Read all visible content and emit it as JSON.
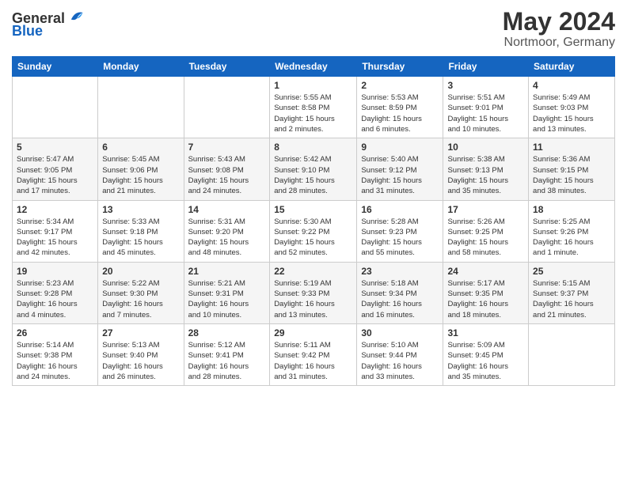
{
  "logo": {
    "general": "General",
    "blue": "Blue"
  },
  "title": {
    "month": "May 2024",
    "location": "Nortmoor, Germany"
  },
  "headers": [
    "Sunday",
    "Monday",
    "Tuesday",
    "Wednesday",
    "Thursday",
    "Friday",
    "Saturday"
  ],
  "weeks": [
    [
      {
        "day": "",
        "info": ""
      },
      {
        "day": "",
        "info": ""
      },
      {
        "day": "",
        "info": ""
      },
      {
        "day": "1",
        "info": "Sunrise: 5:55 AM\nSunset: 8:58 PM\nDaylight: 15 hours\nand 2 minutes."
      },
      {
        "day": "2",
        "info": "Sunrise: 5:53 AM\nSunset: 8:59 PM\nDaylight: 15 hours\nand 6 minutes."
      },
      {
        "day": "3",
        "info": "Sunrise: 5:51 AM\nSunset: 9:01 PM\nDaylight: 15 hours\nand 10 minutes."
      },
      {
        "day": "4",
        "info": "Sunrise: 5:49 AM\nSunset: 9:03 PM\nDaylight: 15 hours\nand 13 minutes."
      }
    ],
    [
      {
        "day": "5",
        "info": "Sunrise: 5:47 AM\nSunset: 9:05 PM\nDaylight: 15 hours\nand 17 minutes."
      },
      {
        "day": "6",
        "info": "Sunrise: 5:45 AM\nSunset: 9:06 PM\nDaylight: 15 hours\nand 21 minutes."
      },
      {
        "day": "7",
        "info": "Sunrise: 5:43 AM\nSunset: 9:08 PM\nDaylight: 15 hours\nand 24 minutes."
      },
      {
        "day": "8",
        "info": "Sunrise: 5:42 AM\nSunset: 9:10 PM\nDaylight: 15 hours\nand 28 minutes."
      },
      {
        "day": "9",
        "info": "Sunrise: 5:40 AM\nSunset: 9:12 PM\nDaylight: 15 hours\nand 31 minutes."
      },
      {
        "day": "10",
        "info": "Sunrise: 5:38 AM\nSunset: 9:13 PM\nDaylight: 15 hours\nand 35 minutes."
      },
      {
        "day": "11",
        "info": "Sunrise: 5:36 AM\nSunset: 9:15 PM\nDaylight: 15 hours\nand 38 minutes."
      }
    ],
    [
      {
        "day": "12",
        "info": "Sunrise: 5:34 AM\nSunset: 9:17 PM\nDaylight: 15 hours\nand 42 minutes."
      },
      {
        "day": "13",
        "info": "Sunrise: 5:33 AM\nSunset: 9:18 PM\nDaylight: 15 hours\nand 45 minutes."
      },
      {
        "day": "14",
        "info": "Sunrise: 5:31 AM\nSunset: 9:20 PM\nDaylight: 15 hours\nand 48 minutes."
      },
      {
        "day": "15",
        "info": "Sunrise: 5:30 AM\nSunset: 9:22 PM\nDaylight: 15 hours\nand 52 minutes."
      },
      {
        "day": "16",
        "info": "Sunrise: 5:28 AM\nSunset: 9:23 PM\nDaylight: 15 hours\nand 55 minutes."
      },
      {
        "day": "17",
        "info": "Sunrise: 5:26 AM\nSunset: 9:25 PM\nDaylight: 15 hours\nand 58 minutes."
      },
      {
        "day": "18",
        "info": "Sunrise: 5:25 AM\nSunset: 9:26 PM\nDaylight: 16 hours\nand 1 minute."
      }
    ],
    [
      {
        "day": "19",
        "info": "Sunrise: 5:23 AM\nSunset: 9:28 PM\nDaylight: 16 hours\nand 4 minutes."
      },
      {
        "day": "20",
        "info": "Sunrise: 5:22 AM\nSunset: 9:30 PM\nDaylight: 16 hours\nand 7 minutes."
      },
      {
        "day": "21",
        "info": "Sunrise: 5:21 AM\nSunset: 9:31 PM\nDaylight: 16 hours\nand 10 minutes."
      },
      {
        "day": "22",
        "info": "Sunrise: 5:19 AM\nSunset: 9:33 PM\nDaylight: 16 hours\nand 13 minutes."
      },
      {
        "day": "23",
        "info": "Sunrise: 5:18 AM\nSunset: 9:34 PM\nDaylight: 16 hours\nand 16 minutes."
      },
      {
        "day": "24",
        "info": "Sunrise: 5:17 AM\nSunset: 9:35 PM\nDaylight: 16 hours\nand 18 minutes."
      },
      {
        "day": "25",
        "info": "Sunrise: 5:15 AM\nSunset: 9:37 PM\nDaylight: 16 hours\nand 21 minutes."
      }
    ],
    [
      {
        "day": "26",
        "info": "Sunrise: 5:14 AM\nSunset: 9:38 PM\nDaylight: 16 hours\nand 24 minutes."
      },
      {
        "day": "27",
        "info": "Sunrise: 5:13 AM\nSunset: 9:40 PM\nDaylight: 16 hours\nand 26 minutes."
      },
      {
        "day": "28",
        "info": "Sunrise: 5:12 AM\nSunset: 9:41 PM\nDaylight: 16 hours\nand 28 minutes."
      },
      {
        "day": "29",
        "info": "Sunrise: 5:11 AM\nSunset: 9:42 PM\nDaylight: 16 hours\nand 31 minutes."
      },
      {
        "day": "30",
        "info": "Sunrise: 5:10 AM\nSunset: 9:44 PM\nDaylight: 16 hours\nand 33 minutes."
      },
      {
        "day": "31",
        "info": "Sunrise: 5:09 AM\nSunset: 9:45 PM\nDaylight: 16 hours\nand 35 minutes."
      },
      {
        "day": "",
        "info": ""
      }
    ]
  ]
}
